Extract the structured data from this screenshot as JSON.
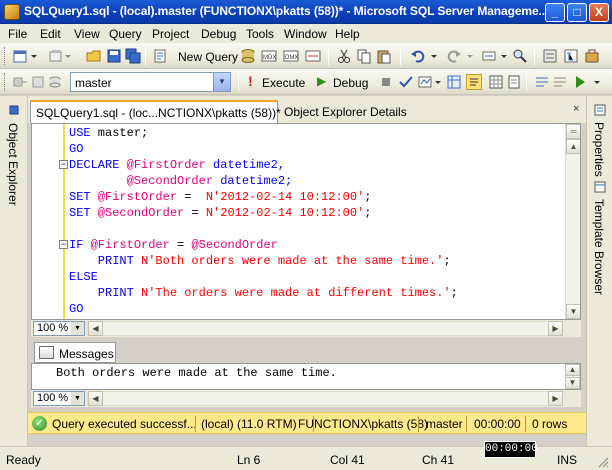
{
  "window": {
    "title": "SQLQuery1.sql - (local).master (FUNCTIONX\\pkatts (58))* - Microsoft SQL Server Manageme...",
    "min_glyph": "_",
    "max_glyph": "□",
    "close_glyph": "X"
  },
  "menu": [
    "File",
    "Edit",
    "View",
    "Query",
    "Project",
    "Debug",
    "Tools",
    "Window",
    "Help"
  ],
  "toolbar1": {
    "new_query_label": "New Query"
  },
  "toolbar2": {
    "database_value": "master",
    "execute_label": "Execute",
    "debug_label": "Debug",
    "execute_glyph": "!",
    "debug_glyph": "▶"
  },
  "side_panels": {
    "left": "Object Explorer",
    "right_top": "Properties",
    "right_bottom": "Template Browser"
  },
  "tabs": {
    "active": "SQLQuery1.sql - (loc...NCTIONX\\pkatts (58))*",
    "inactive": "Object Explorer Details",
    "close_glyph": "×"
  },
  "code": {
    "l1a": "USE",
    "l1b": " master;",
    "l2a": "GO",
    "l3a": "DECLARE",
    "l3b": " @FirstOrder",
    "l3c": " datetime2,",
    "l4b": "        @SecondOrder",
    "l4c": " datetime2;",
    "l5a": "SET",
    "l5b": " @FirstOrder",
    "l5c": " =  ",
    "l5d": "N'2012-02-14 10:12:00'",
    "l5e": ";",
    "l6a": "SET",
    "l6b": " @SecondOrder",
    "l6c": " = ",
    "l6d": "N'2012-02-14 10:12:00'",
    "l6e": ";",
    "l8a": "IF",
    "l8b": " @FirstOrder",
    "l8c": " = ",
    "l8d": "@SecondOrder",
    "l9a": "    PRINT",
    "l9b": " N'Both orders were made at the same time.'",
    "l9c": ";",
    "l10a": "ELSE",
    "l11a": "    PRINT",
    "l11b": " N'The orders were made at different times.'",
    "l11c": ";",
    "l12a": "GO",
    "fold_glyph": "−"
  },
  "editor": {
    "zoom": "100 %"
  },
  "messages": {
    "tab_label": "Messages",
    "text": "Both orders were made at the same time.",
    "zoom": "100 %"
  },
  "query_status": {
    "ok_glyph": "✓",
    "message": "Query executed successf...",
    "server": "(local) (11.0 RTM)",
    "user": "FUNCTIONX\\pkatts (58)",
    "database": "master",
    "elapsed": "00:00:00",
    "rows": "0 rows"
  },
  "statusbar": {
    "ready": "Ready",
    "ln": "Ln 6",
    "col": "Col 41",
    "ch": "Ch 41",
    "ins": "INS",
    "tooltip": "00:00:00"
  },
  "colors": {
    "keyword": "#0000ff",
    "string": "#ff0000",
    "variable": "#e8007a",
    "titlebar": "#0a3fb8",
    "status_yellow": "#ffe98a"
  }
}
